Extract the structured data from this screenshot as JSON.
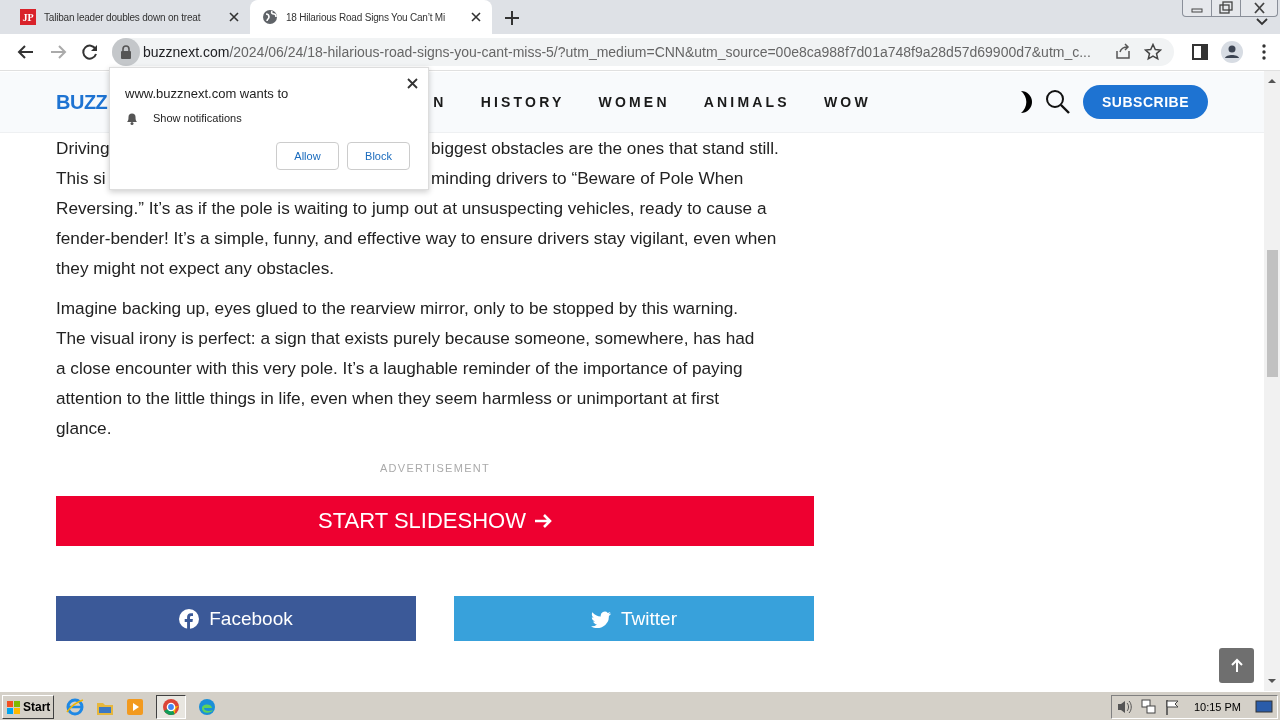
{
  "browser": {
    "tabs": [
      {
        "title": "Taliban leader doubles down on treat",
        "selected": false,
        "favicon": {
          "kind": "letters",
          "text": "JP"
        }
      },
      {
        "title": "18 Hilarious Road Signs You Can’t Mi",
        "selected": true,
        "favicon": {
          "kind": "globe"
        }
      }
    ],
    "address": {
      "host": "buzznext.com",
      "path": "/2024/06/24/18-hilarious-road-signs-you-cant-miss-5/?utm_medium=CNN&utm_source=00e8ca988f7d01a748f9a28d57d69900d7&utm_c..."
    }
  },
  "site": {
    "logo": "BUZZ",
    "nav": [
      "N",
      "HISTORY",
      "WOMEN",
      "ANIMALS",
      "WOW"
    ],
    "subscribe": "SUBSCRIBE"
  },
  "article": {
    "paragraphs": [
      {
        "lines": [
          [
            "Driving",
            "biggest obstacles are the ones that stand still."
          ],
          [
            "This si",
            "minding drivers to “Beware of Pole When"
          ],
          [
            "Reversing.” It’s as if the pole is waiting to jump out at unsuspecting vehicles, ready to cause a"
          ],
          [
            "fender-bender! It’s a simple, funny, and effective way to ensure drivers stay vigilant, even when"
          ],
          [
            "they might not expect any obstacles."
          ]
        ]
      },
      {
        "lines": [
          [
            "Imagine backing up, eyes glued to the rearview mirror, only to be stopped by this warning."
          ],
          [
            "The visual irony is perfect: a sign that exists purely because someone, somewhere, has had"
          ],
          [
            "a close encounter with this very pole. It’s a laughable reminder of the importance of paying"
          ],
          [
            "attention to the little things in life, even when they seem harmless or unimportant at first"
          ],
          [
            "glance."
          ]
        ]
      }
    ],
    "ad_label": "ADVERTISEMENT",
    "slideshow": "START SLIDESHOW",
    "share": [
      {
        "kind": "facebook",
        "label": "Facebook"
      },
      {
        "kind": "twitter",
        "label": "Twitter"
      }
    ]
  },
  "popup": {
    "title": "www.buzznext.com wants to",
    "item": "Show notifications",
    "buttons": [
      "Allow",
      "Block"
    ]
  },
  "taskbar": {
    "start": "Start",
    "clock": "10:15 PM"
  }
}
